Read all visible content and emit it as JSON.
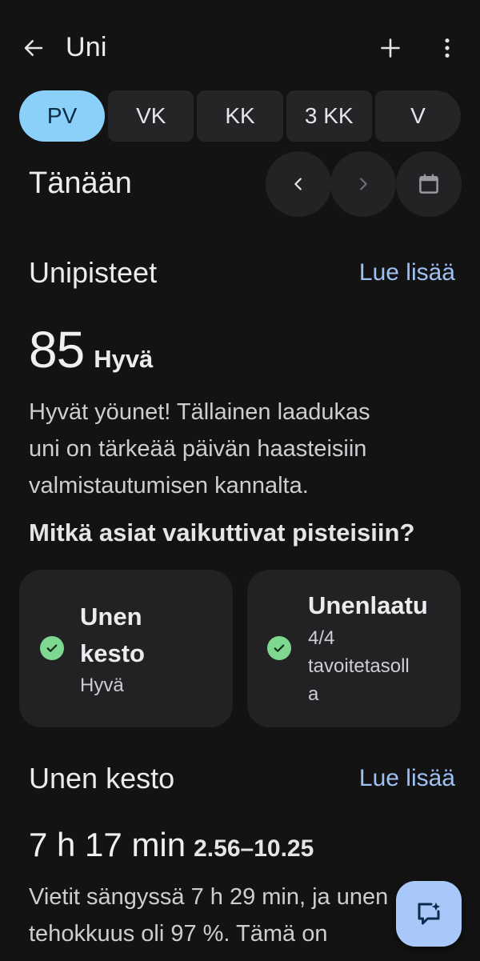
{
  "appbar": {
    "title": "Uni",
    "back_icon": "arrow-left-icon",
    "add_icon": "plus-icon",
    "more_icon": "more-vert-icon"
  },
  "tabs": [
    {
      "label": "PV",
      "active": true
    },
    {
      "label": "VK",
      "active": false
    },
    {
      "label": "KK",
      "active": false
    },
    {
      "label": "3 KK",
      "active": false
    },
    {
      "label": "V",
      "active": false
    }
  ],
  "date_nav": {
    "label": "Tänään",
    "prev_icon": "chevron-left-icon",
    "next_icon": "chevron-right-icon",
    "calendar_icon": "calendar-icon"
  },
  "sleep_score": {
    "title": "Unipisteet",
    "link": "Lue lisää",
    "value": "85",
    "rating": "Hyvä",
    "description_lines": [
      "Hyvät yöunet! Tällainen laadukas",
      "uni on tärkeää päivän haasteisiin",
      "valmistautumisen kannalta."
    ],
    "factors_heading": "Mitkä asiat vaikuttivat pisteisiin?",
    "factors": [
      {
        "title_lines": [
          "Unen",
          "kesto"
        ],
        "sub_lines": [
          "Hyvä"
        ]
      },
      {
        "title_lines": [
          "Unenlaatu"
        ],
        "sub_lines": [
          "4/4",
          "tavoitetasoll",
          "a"
        ]
      }
    ]
  },
  "sleep_duration": {
    "title": "Unen kesto",
    "link": "Lue lisää",
    "value": "7 h 17 min",
    "range": "2.56–10.25",
    "description_lines": [
      "Vietit sängyssä 7 h 29 min, ja unen",
      "tehokkuus oli 97 %. Tämä on"
    ]
  },
  "fab": {
    "icon": "chat-sparkle-icon"
  },
  "colors": {
    "background": "#131313",
    "surface": "#222224",
    "accent_tab": "#8bd0f8",
    "link": "#9fc1f2",
    "check": "#7ed88f",
    "fab": "#a8c8fa"
  }
}
